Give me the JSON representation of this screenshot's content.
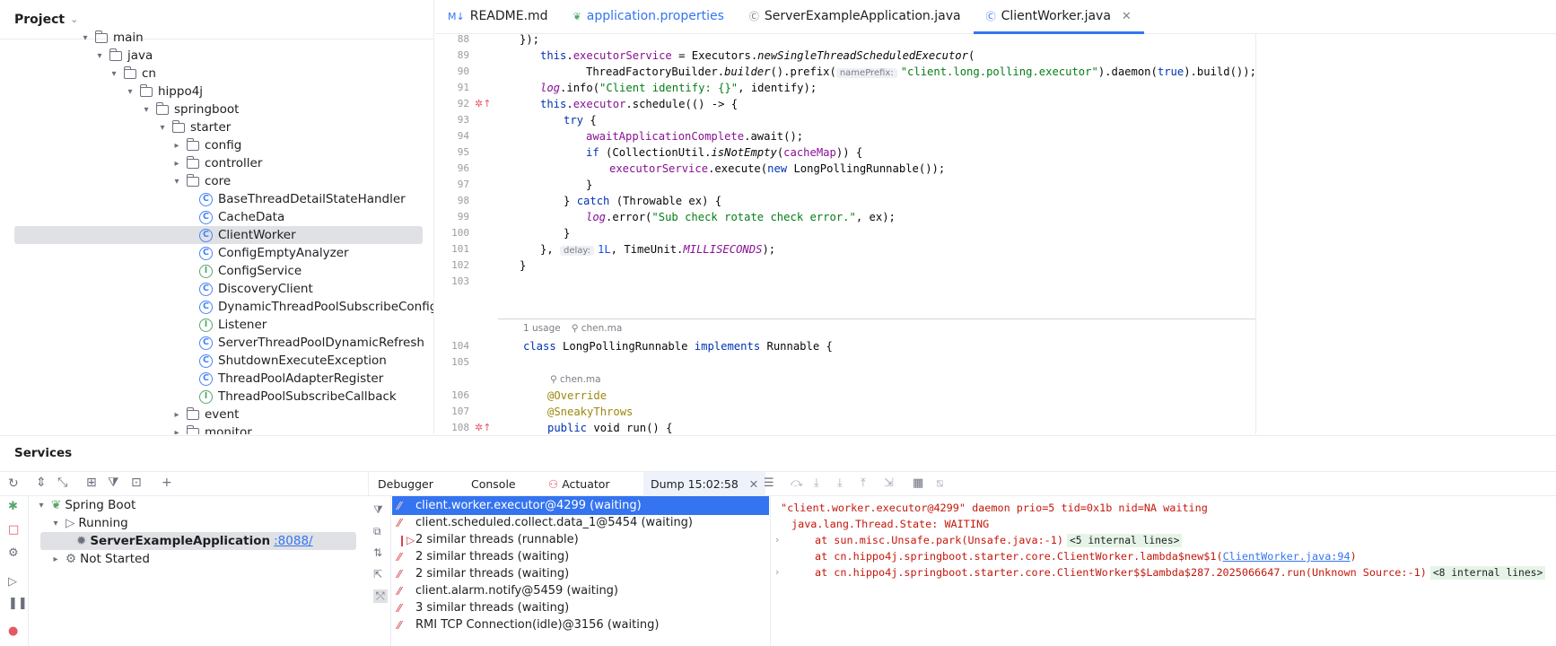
{
  "project": {
    "title": "Project",
    "tree": [
      {
        "label": "main",
        "kind": "folder",
        "arrow": "▾"
      },
      {
        "label": "java",
        "kind": "folder",
        "arrow": "▾"
      },
      {
        "label": "cn",
        "kind": "folder",
        "arrow": "▾"
      },
      {
        "label": "hippo4j",
        "kind": "folder",
        "arrow": "▾"
      },
      {
        "label": "springboot",
        "kind": "folder",
        "arrow": "▾"
      },
      {
        "label": "starter",
        "kind": "folder",
        "arrow": "▾"
      },
      {
        "label": "config",
        "kind": "folder",
        "arrow": "▸"
      },
      {
        "label": "controller",
        "kind": "folder",
        "arrow": "▸"
      },
      {
        "label": "core",
        "kind": "folder",
        "arrow": "▾"
      },
      {
        "label": "BaseThreadDetailStateHandler",
        "kind": "class"
      },
      {
        "label": "CacheData",
        "kind": "class"
      },
      {
        "label": "ClientWorker",
        "kind": "class",
        "selected": true
      },
      {
        "label": "ConfigEmptyAnalyzer",
        "kind": "class"
      },
      {
        "label": "ConfigService",
        "kind": "interface"
      },
      {
        "label": "DiscoveryClient",
        "kind": "class"
      },
      {
        "label": "DynamicThreadPoolSubscribeConfig",
        "kind": "class"
      },
      {
        "label": "Listener",
        "kind": "interface"
      },
      {
        "label": "ServerThreadPoolDynamicRefresh",
        "kind": "class"
      },
      {
        "label": "ShutdownExecuteException",
        "kind": "class"
      },
      {
        "label": "ThreadPoolAdapterRegister",
        "kind": "class"
      },
      {
        "label": "ThreadPoolSubscribeCallback",
        "kind": "interface"
      },
      {
        "label": "event",
        "kind": "folder",
        "arrow": "▸"
      },
      {
        "label": "monitor",
        "kind": "folder",
        "arrow": "▸"
      }
    ]
  },
  "editor": {
    "tabs": [
      {
        "label": "README.md",
        "icon": "M↓"
      },
      {
        "label": "application.properties",
        "icon": "❦"
      },
      {
        "label": "ServerExampleApplication.java",
        "icon": "Ⓒ"
      },
      {
        "label": "ClientWorker.java",
        "icon": "Ⓒ",
        "active": true
      }
    ],
    "line_numbers": [
      "88",
      "89",
      "90",
      "91",
      "92",
      "93",
      "94",
      "95",
      "96",
      "97",
      "98",
      "99",
      "100",
      "101",
      "102",
      "103",
      "104",
      "105",
      "106",
      "107",
      "108"
    ],
    "usage_meta": {
      "usages": "1 usage",
      "author": "chen.ma"
    },
    "override_author": "chen.ma",
    "hints": {
      "name_prefix": "namePrefix:",
      "delay": "delay:"
    },
    "code": {
      "l88": "});",
      "l89_a": "this",
      "l89_b": ".",
      "l89_c": "executorService",
      "l89_d": " = Executors.",
      "l89_e": "newSingleThreadScheduledExecutor",
      "l89_f": "(",
      "l90_a": "ThreadFactoryBuilder.",
      "l90_b": "builder",
      "l90_c": "().prefix(",
      "l90_d": "\"client.long.polling.executor\"",
      "l90_e": ").daemon(",
      "l90_f": "true",
      "l90_g": ").build());",
      "l91_a": "log",
      "l91_b": ".info(",
      "l91_c": "\"Client identify: {}\"",
      "l91_d": ", identify);",
      "l92_a": "this",
      "l92_b": ".",
      "l92_c": "executor",
      "l92_d": ".schedule(() -> {",
      "l93": "try",
      "l93b": " {",
      "l94_a": "awaitApplicationComplete",
      "l94_b": ".await();",
      "l95_a": "if",
      "l95_b": " (CollectionUtil.",
      "l95_c": "isNotEmpty",
      "l95_d": "(",
      "l95_e": "cacheMap",
      "l95_f": ")) {",
      "l96_a": "executorService",
      "l96_b": ".execute(",
      "l96_c": "new",
      "l96_d": " LongPollingRunnable());",
      "l97": "}",
      "l98_a": "} ",
      "l98_b": "catch",
      "l98_c": " (Throwable ex) {",
      "l99_a": "log",
      "l99_b": ".error(",
      "l99_c": "\"Sub check rotate check error.\"",
      "l99_d": ", ex);",
      "l100": "}",
      "l101_a": "}, ",
      "l101_b": "1L",
      "l101_c": ", TimeUnit.",
      "l101_d": "MILLISECONDS",
      "l101_e": ");",
      "l102": "}",
      "l104_a": "class",
      "l104_b": " LongPollingRunnable ",
      "l104_c": "implements",
      "l104_d": " Runnable {",
      "l106": "@Override",
      "l107": "@SneakyThrows",
      "l108_a": "public",
      "l108_b": " void run() {"
    }
  },
  "services": {
    "title": "Services",
    "tree": {
      "root": "Spring Boot",
      "running": "Running",
      "app": "ServerExampleApplication",
      "port": ":8088/",
      "not_started": "Not Started"
    }
  },
  "debugger": {
    "tabs": [
      "Debugger",
      "Console",
      "Actuator",
      "Dump 15:02:58"
    ],
    "threads": [
      {
        "label": "client.worker.executor@4299 (waiting)",
        "selected": true
      },
      {
        "label": "client.scheduled.collect.data_1@5454 (waiting)"
      },
      {
        "label": "2 similar threads (runnable)"
      },
      {
        "label": "2 similar threads (waiting)"
      },
      {
        "label": "2 similar threads (waiting)"
      },
      {
        "label": "client.alarm.notify@5459 (waiting)"
      },
      {
        "label": "3 similar threads (waiting)"
      },
      {
        "label": "RMI TCP Connection(idle)@3156 (waiting)"
      }
    ],
    "dump": {
      "header": "\"client.worker.executor@4299\" daemon prio=5 tid=0x1b nid=NA waiting",
      "state": "java.lang.Thread.State: WAITING",
      "frame1": "at sun.misc.Unsafe.park(Unsafe.java:-1)",
      "frame1_internal": "<5 internal lines>",
      "frame2_a": "at cn.hippo4j.springboot.starter.core.ClientWorker.lambda$new$1(",
      "frame2_link": "ClientWorker.java:94",
      "frame2_b": ")",
      "frame3": "at cn.hippo4j.springboot.starter.core.ClientWorker$$Lambda$287.2025066647.run(Unknown Source:-1)",
      "frame3_internal": "<8 internal lines>"
    }
  },
  "colors": {
    "accent": "#3574f0",
    "error": "#c4170b",
    "selection": "#dfe1e5"
  }
}
